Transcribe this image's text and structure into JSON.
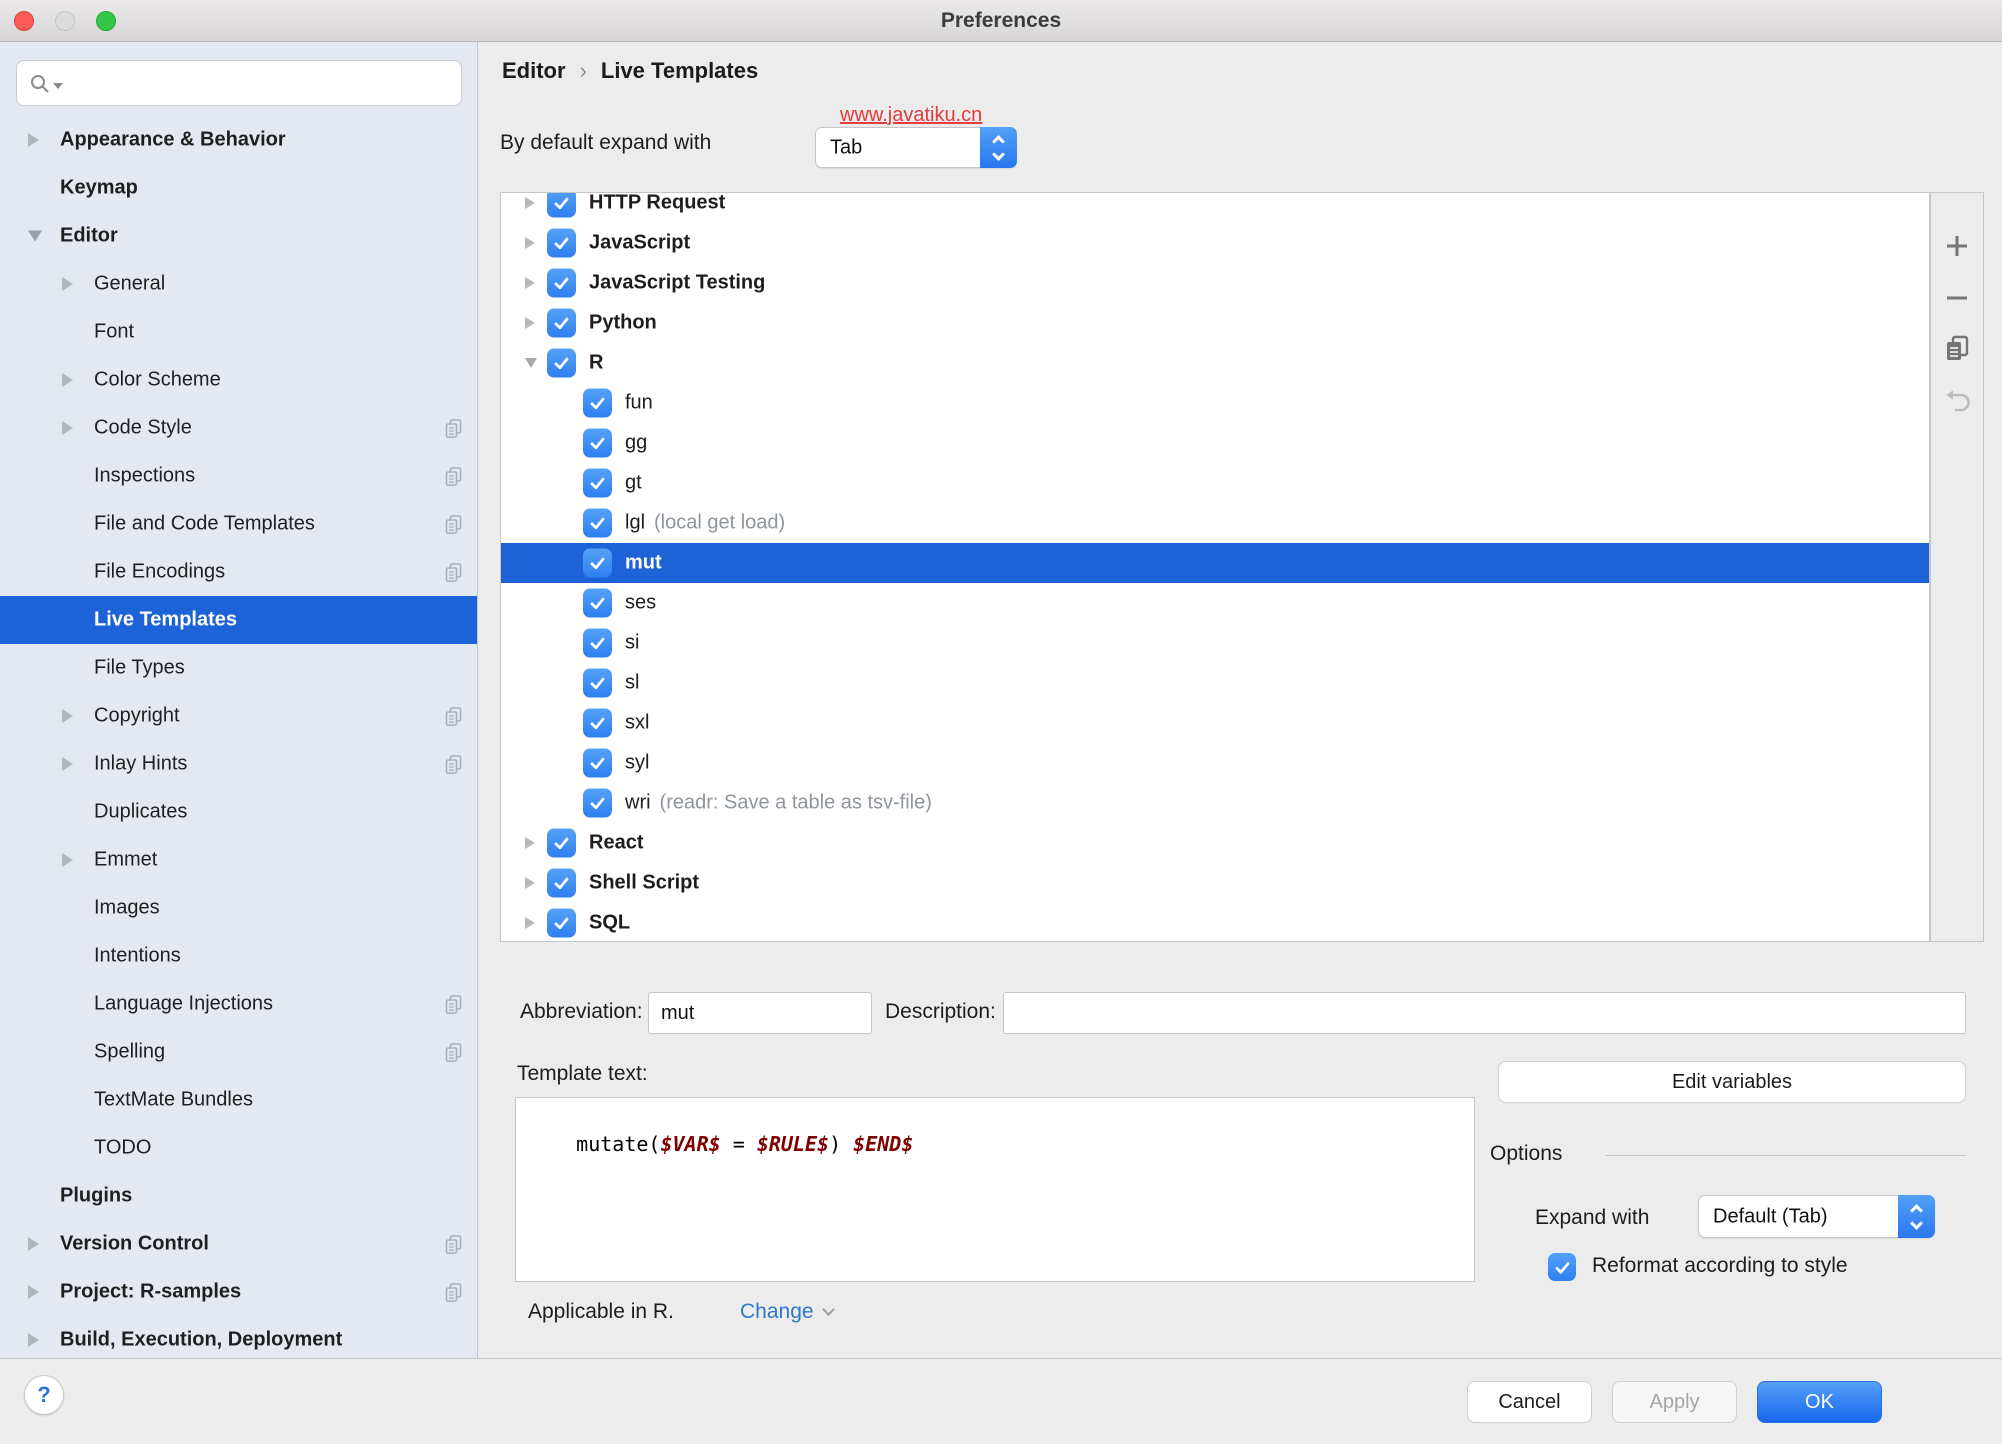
{
  "window": {
    "title": "Preferences",
    "controls": [
      "close",
      "minimize",
      "zoom"
    ]
  },
  "colors": {
    "selection_blue": "#1d62d6",
    "checkbox_blue": "#3f8ef6",
    "ok_button_blue": "#1767ee",
    "link_blue": "#2e77d0",
    "watermark_red": "#e23c3c",
    "template_variable_red": "#7f0000",
    "sidebar_background": "#e4e9f1"
  },
  "sidebar": {
    "search_placeholder": "",
    "items": [
      {
        "label": "Appearance & Behavior",
        "bold": true,
        "arrow": "right",
        "indent": 0
      },
      {
        "label": "Keymap",
        "bold": true,
        "indent": 0
      },
      {
        "label": "Editor",
        "bold": true,
        "arrow": "down",
        "indent": 0
      },
      {
        "label": "General",
        "arrow": "right",
        "indent": 1
      },
      {
        "label": "Font",
        "indent": 1
      },
      {
        "label": "Color Scheme",
        "arrow": "right",
        "indent": 1
      },
      {
        "label": "Code Style",
        "arrow": "right",
        "indent": 1,
        "copy_icon": true
      },
      {
        "label": "Inspections",
        "indent": 1,
        "copy_icon": true
      },
      {
        "label": "File and Code Templates",
        "indent": 1,
        "copy_icon": true
      },
      {
        "label": "File Encodings",
        "indent": 1,
        "copy_icon": true
      },
      {
        "label": "Live Templates",
        "indent": 1,
        "selected": true
      },
      {
        "label": "File Types",
        "indent": 1
      },
      {
        "label": "Copyright",
        "arrow": "right",
        "indent": 1,
        "copy_icon": true
      },
      {
        "label": "Inlay Hints",
        "arrow": "right",
        "indent": 1,
        "copy_icon": true
      },
      {
        "label": "Duplicates",
        "indent": 1
      },
      {
        "label": "Emmet",
        "arrow": "right",
        "indent": 1
      },
      {
        "label": "Images",
        "indent": 1
      },
      {
        "label": "Intentions",
        "indent": 1
      },
      {
        "label": "Language Injections",
        "indent": 1,
        "copy_icon": true
      },
      {
        "label": "Spelling",
        "indent": 1,
        "copy_icon": true
      },
      {
        "label": "TextMate Bundles",
        "indent": 1
      },
      {
        "label": "TODO",
        "indent": 1
      },
      {
        "label": "Plugins",
        "bold": true,
        "indent": 0
      },
      {
        "label": "Version Control",
        "bold": true,
        "arrow": "right",
        "indent": 0,
        "copy_icon": true
      },
      {
        "label": "Project: R-samples",
        "bold": true,
        "arrow": "right",
        "indent": 0,
        "copy_icon": true
      },
      {
        "label": "Build, Execution, Deployment",
        "bold": true,
        "arrow": "right",
        "indent": 0
      }
    ]
  },
  "header": {
    "breadcrumb": [
      "Editor",
      "Live Templates"
    ],
    "breadcrumb_separator": "›",
    "watermark": "www.javatiku.cn",
    "expand_default_label": "By default expand with",
    "expand_default_value": "Tab"
  },
  "tree": {
    "rows": [
      {
        "label": "HTTP Request",
        "level": "group",
        "arrow": "right",
        "checked": true
      },
      {
        "label": "JavaScript",
        "level": "group",
        "arrow": "right",
        "checked": true
      },
      {
        "label": "JavaScript Testing",
        "level": "group",
        "arrow": "right",
        "checked": true
      },
      {
        "label": "Python",
        "level": "group",
        "arrow": "right",
        "checked": true
      },
      {
        "label": "R",
        "level": "group",
        "arrow": "down",
        "checked": true
      },
      {
        "label": "fun",
        "level": "child",
        "checked": true
      },
      {
        "label": "gg",
        "level": "child",
        "checked": true
      },
      {
        "label": "gt",
        "level": "child",
        "checked": true
      },
      {
        "label": "lgl",
        "level": "child",
        "checked": true,
        "desc": "(local get load)"
      },
      {
        "label": "mut",
        "level": "child",
        "checked": true,
        "selected": true
      },
      {
        "label": "ses",
        "level": "child",
        "checked": true
      },
      {
        "label": "si",
        "level": "child",
        "checked": true
      },
      {
        "label": "sl",
        "level": "child",
        "checked": true
      },
      {
        "label": "sxl",
        "level": "child",
        "checked": true
      },
      {
        "label": "syl",
        "level": "child",
        "checked": true
      },
      {
        "label": "wri",
        "level": "child",
        "checked": true,
        "desc": "(readr: Save a table as tsv-file)"
      },
      {
        "label": "React",
        "level": "group",
        "arrow": "right",
        "checked": true
      },
      {
        "label": "Shell Script",
        "level": "group",
        "arrow": "right",
        "checked": true
      },
      {
        "label": "SQL",
        "level": "group",
        "arrow": "right",
        "checked": true
      }
    ]
  },
  "toolbar": {
    "icons": [
      "add",
      "remove",
      "duplicate",
      "revert"
    ]
  },
  "details": {
    "abbreviation_label": "Abbreviation:",
    "abbreviation_value": "mut",
    "description_label": "Description:",
    "description_value": "",
    "template_text_label": "Template text:",
    "template_segments": [
      {
        "text": "mutate(",
        "kind": "plain"
      },
      {
        "text": "$VAR$",
        "kind": "var"
      },
      {
        "text": " = ",
        "kind": "plain"
      },
      {
        "text": "$RULE$",
        "kind": "var"
      },
      {
        "text": ") ",
        "kind": "plain"
      },
      {
        "text": "$END$",
        "kind": "var"
      }
    ],
    "edit_variables_label": "Edit variables",
    "options_label": "Options",
    "expand_with_label": "Expand with",
    "expand_with_value": "Default (Tab)",
    "reformat_checked": true,
    "reformat_label": "Reformat according to style",
    "applicable_label": "Applicable in R.",
    "change_label": "Change"
  },
  "footer": {
    "help_label": "?",
    "cancel_label": "Cancel",
    "apply_label": "Apply",
    "ok_label": "OK"
  }
}
